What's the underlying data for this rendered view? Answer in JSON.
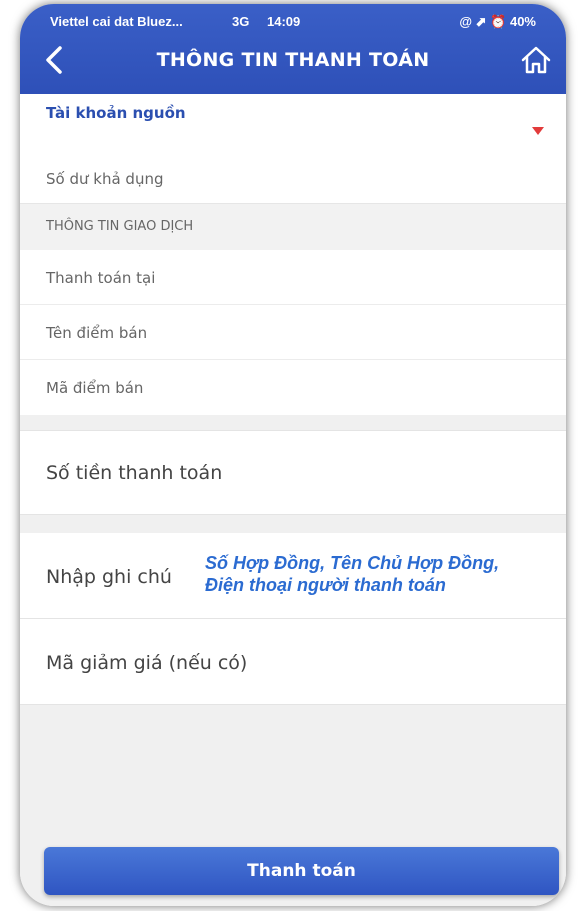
{
  "status_bar": {
    "carrier": "Viettel cai dat Bluez...",
    "network": "3G",
    "time": "14:09",
    "right": "@ ⬈ ⏰ 40%"
  },
  "header": {
    "title": "THÔNG TIN THANH TOÁN",
    "back_icon": "chevron-left-icon",
    "home_icon": "home-icon"
  },
  "source_account": {
    "label": "Tài khoản nguồn",
    "balance_label": "Số dư khả dụng"
  },
  "transaction_section": {
    "header": "THÔNG TIN GIAO DỊCH",
    "pay_at": "Thanh toán tại",
    "merchant_name": "Tên điểm bán",
    "merchant_code": "Mã điểm bán"
  },
  "amount": {
    "placeholder": "Số tiền thanh toán"
  },
  "note": {
    "placeholder": "Nhập ghi chú",
    "hint_line1": "Số Hợp Đồng, Tên Chủ Hợp Đồng,",
    "hint_line2": "Điện thoại người thanh toán"
  },
  "discount": {
    "placeholder": "Mã giảm giá (nếu có)"
  },
  "submit_button": {
    "label": "Thanh toán"
  },
  "colors": {
    "header_blue": "#2e50b8",
    "accent_red": "#e23b3b",
    "hint_blue": "#2b6bd1"
  }
}
